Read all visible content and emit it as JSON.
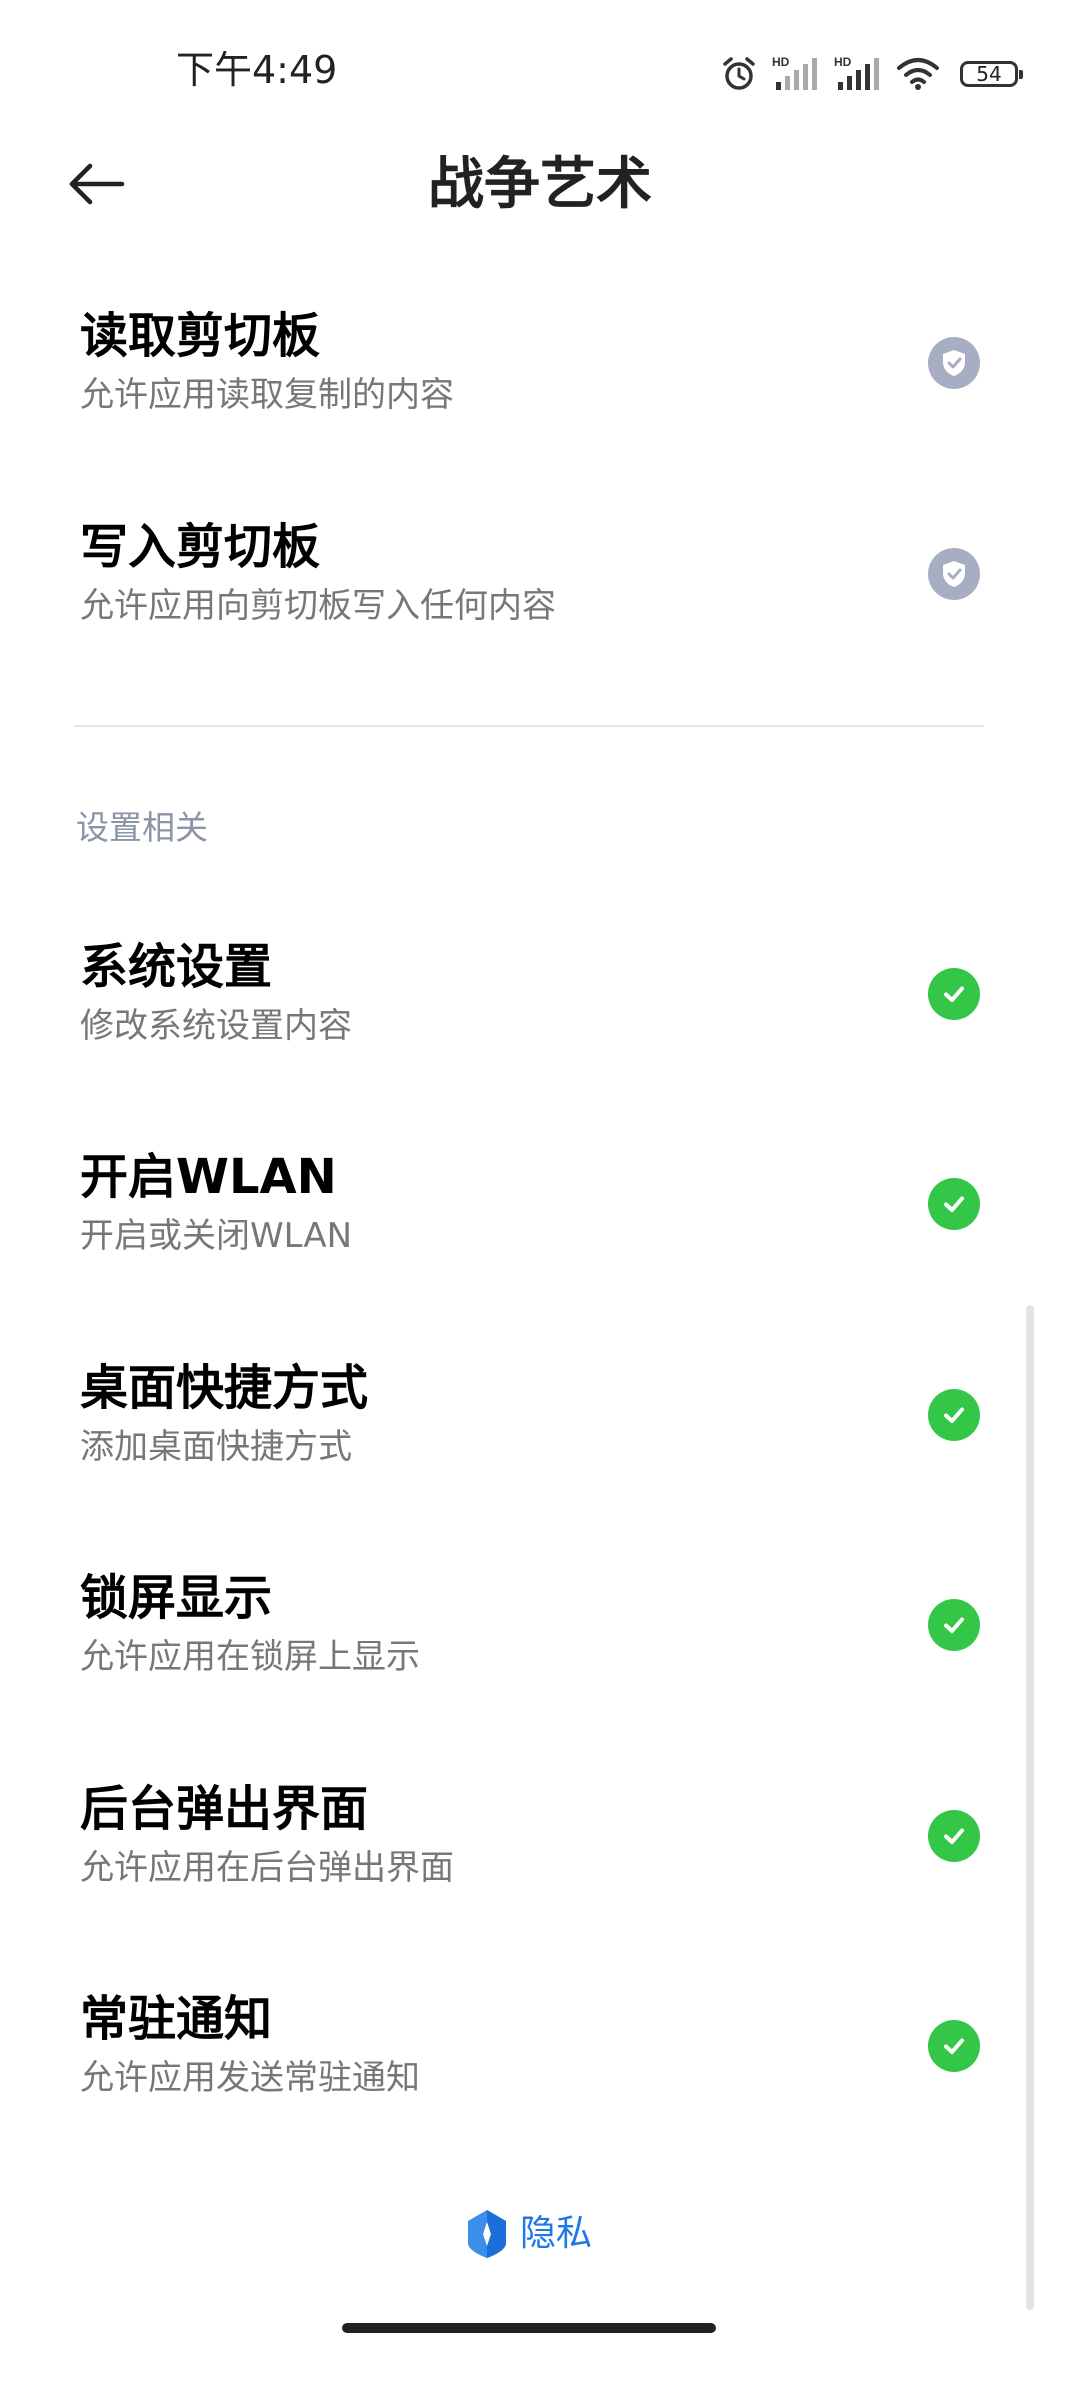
{
  "status_bar": {
    "time": "下午4:49",
    "signal_1_label": "HD",
    "signal_2_label": "HD",
    "battery": "54",
    "icons": [
      "alarm-icon",
      "signal-icon",
      "signal-icon",
      "wifi-icon",
      "battery-icon"
    ]
  },
  "header": {
    "back_icon": "arrow-left-icon",
    "title": "战争艺术"
  },
  "clipboard_items": [
    {
      "title": "读取剪切板",
      "desc": "允许应用读取复制的内容",
      "icon": "shield-check-icon",
      "state": "grey"
    },
    {
      "title": "写入剪切板",
      "desc": "允许应用向剪切板写入任何内容",
      "icon": "shield-check-icon",
      "state": "grey"
    }
  ],
  "settings_section": {
    "header": "设置相关",
    "items": [
      {
        "title": "系统设置",
        "desc": "修改系统设置内容",
        "icon": "check-icon",
        "state": "green"
      },
      {
        "title": "开启WLAN",
        "desc": "开启或关闭WLAN",
        "icon": "check-icon",
        "state": "green"
      },
      {
        "title": "桌面快捷方式",
        "desc": "添加桌面快捷方式",
        "icon": "check-icon",
        "state": "green"
      },
      {
        "title": "锁屏显示",
        "desc": "允许应用在锁屏上显示",
        "icon": "check-icon",
        "state": "green"
      },
      {
        "title": "后台弹出界面",
        "desc": "允许应用在后台弹出界面",
        "icon": "check-icon",
        "state": "green"
      },
      {
        "title": "常驻通知",
        "desc": "允许应用发送常驻通知",
        "icon": "check-icon",
        "state": "green"
      }
    ]
  },
  "footer": {
    "privacy_label": "隐私",
    "privacy_icon": "privacy-shield-icon"
  },
  "colors": {
    "granted": "#34C747",
    "grey": "#A7AEC4",
    "section_header": "#8A95A8",
    "link": "#1E78E6"
  }
}
